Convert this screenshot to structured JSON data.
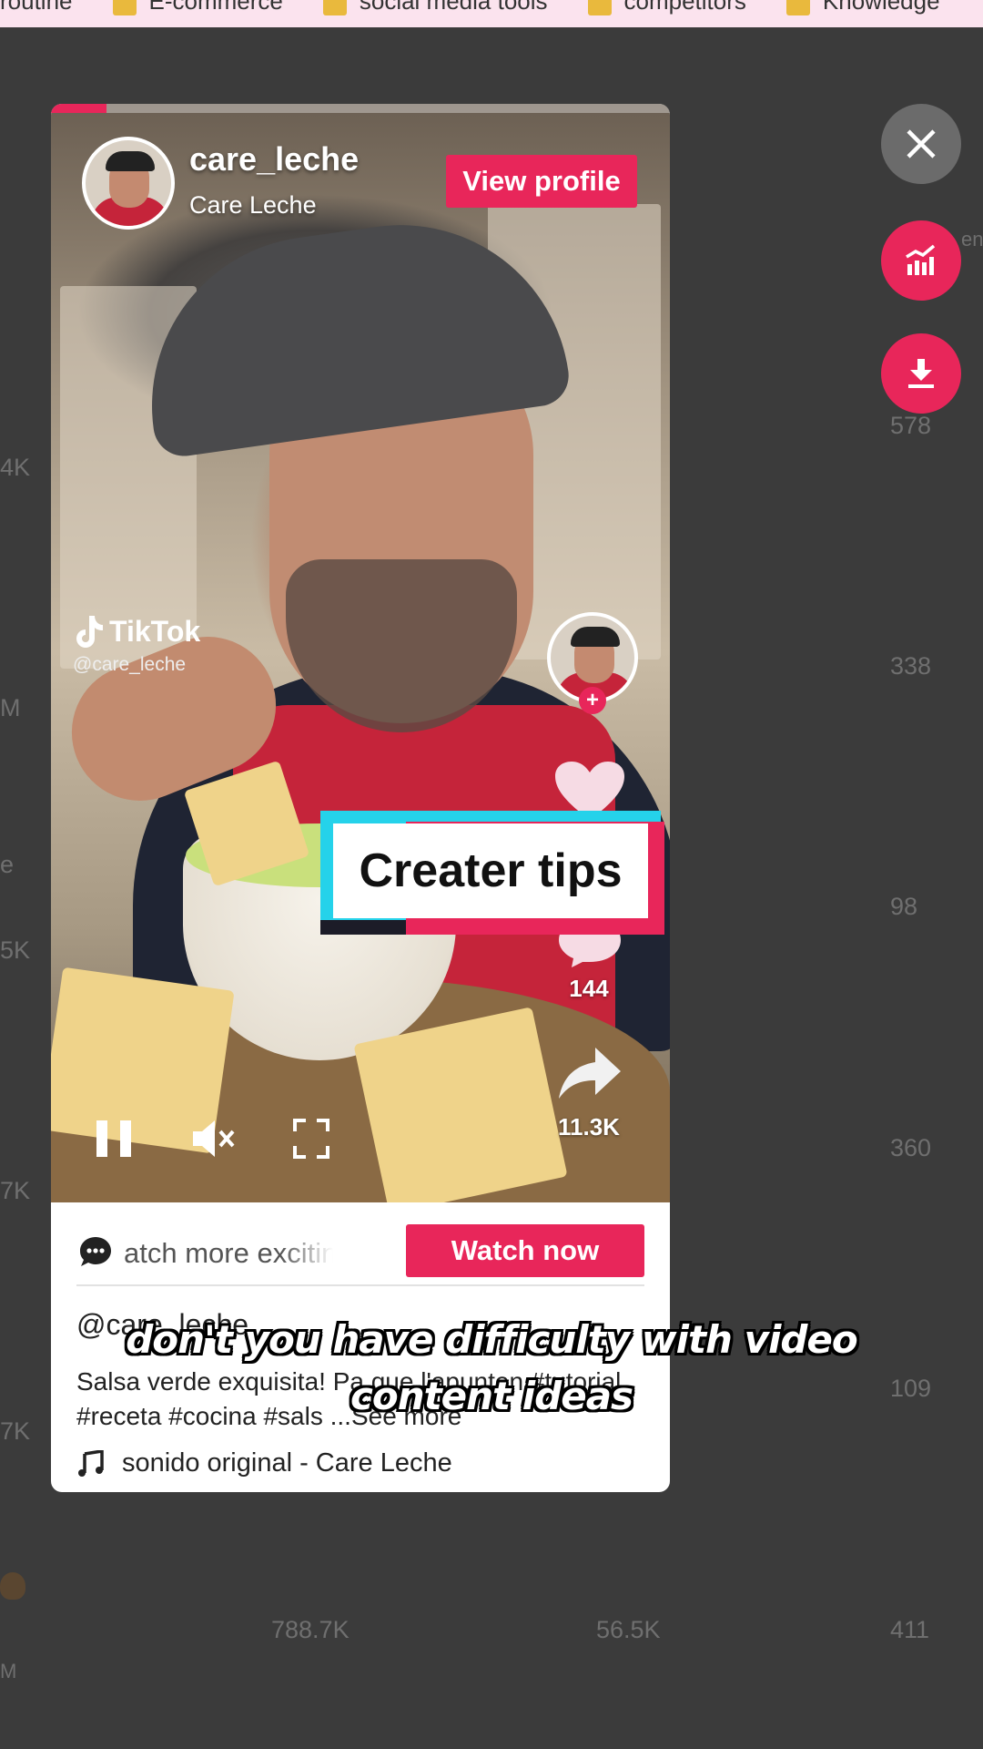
{
  "bookmarks": [
    {
      "label": "routine"
    },
    {
      "label": "E-commerce"
    },
    {
      "label": "social media tools"
    },
    {
      "label": "competitors"
    },
    {
      "label": "Knowledge"
    }
  ],
  "background_table": {
    "right_column": [
      "578",
      "338",
      "98",
      "360",
      "109",
      "411"
    ],
    "left_column": [
      "4K",
      "M",
      "e",
      "5K",
      "7K",
      "7K",
      "M"
    ],
    "bottom_row": [
      "788.7K",
      "56.5K"
    ],
    "right_edge_label": "en"
  },
  "video": {
    "progress": 0.09,
    "author": {
      "username": "care_leche",
      "display_name": "Care Leche"
    },
    "view_profile_label": "View profile",
    "watermark": {
      "brand": "TikTok",
      "handle": "@care_leche"
    },
    "comment_count": "144",
    "share_count": "11.3K",
    "overlay_title": "Creater tips",
    "icons": {
      "pause": "pause-icon",
      "mute": "muted-icon",
      "fullscreen": "fullscreen-icon"
    }
  },
  "footer": {
    "banner_text": "atch more exciting v",
    "watch_now_label": "Watch now",
    "caption_handle": "@care_leche",
    "caption_text": "Salsa verde exquisita! Pa que l'apunten #tutorial #receta #cocina #sals ...See more",
    "music": "sonido original - Care Leche"
  },
  "side_actions": {
    "close": "close-icon",
    "analytics": "analytics-icon",
    "download": "download-icon"
  },
  "subtitle": "don't you have difficulty with video content ideas",
  "colors": {
    "accent": "#e8265a",
    "cyan": "#25d2ea",
    "background": "#3b3b3b"
  }
}
